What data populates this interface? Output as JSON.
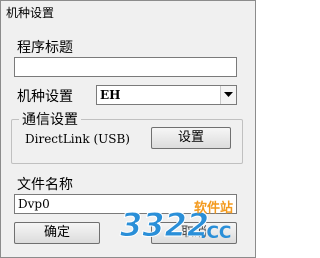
{
  "window": {
    "title": "机种设置"
  },
  "program_title": {
    "label": "程序标题",
    "value": ""
  },
  "model": {
    "label": "机种设置",
    "selected": "EH"
  },
  "comm": {
    "label": "通信设置",
    "connection": "DirectLink (USB)",
    "settings_button": "设置"
  },
  "filename": {
    "label": "文件名称",
    "value": "Dvp0"
  },
  "buttons": {
    "ok": "确定",
    "cancel": "取消"
  },
  "watermark": {
    "brand": "3322",
    "tag": "软件站",
    "domain": ".CC"
  },
  "colors": {
    "dialog_bg": "#f0f0f0",
    "watermark_blue": "#2a8fd8",
    "watermark_orange": "#f39a1e"
  }
}
